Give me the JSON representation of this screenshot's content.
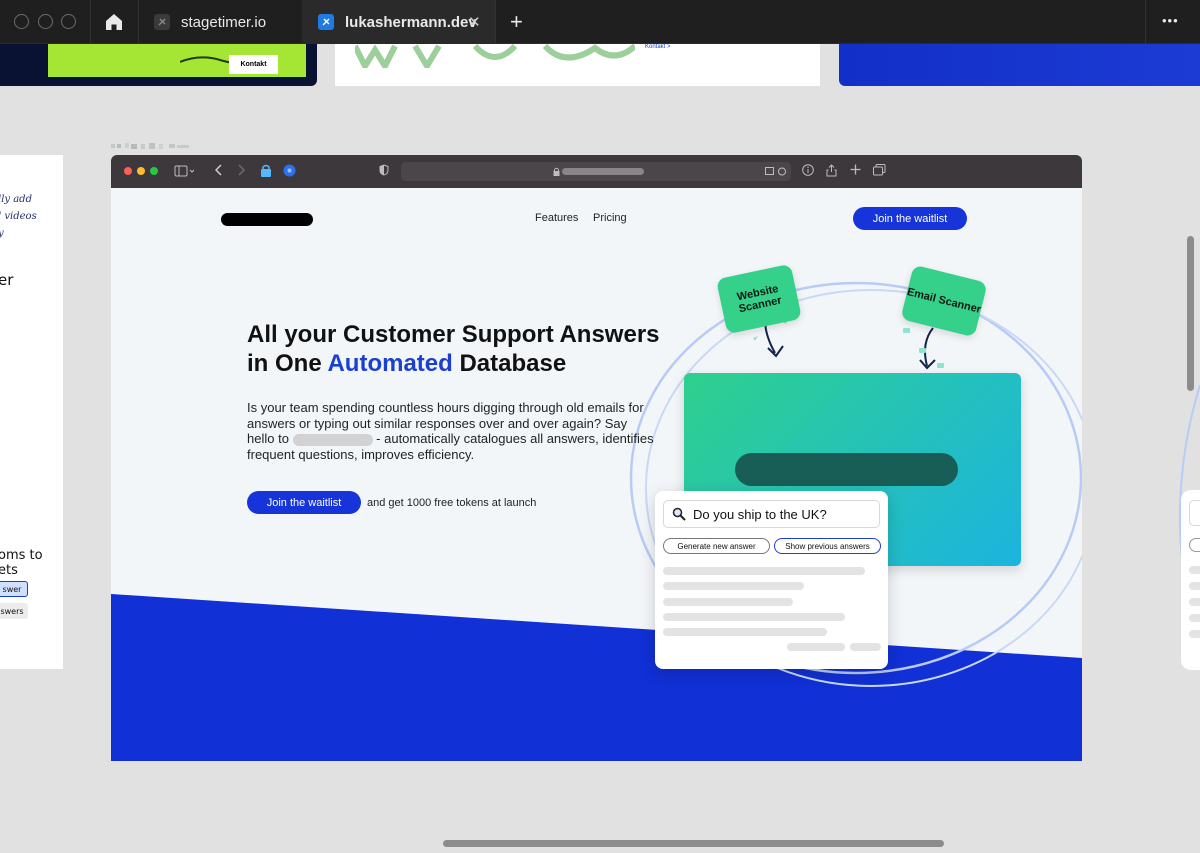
{
  "browser": {
    "tabs": [
      {
        "label": "stagetimer.io",
        "active": false
      },
      {
        "label": "lukashermann.dev",
        "active": true
      }
    ],
    "new_tab_symbol": "+",
    "more_symbol": "•••",
    "close_symbol": "✕"
  },
  "thumbnails": {
    "first_button": "Kontakt",
    "second_link": "Kontakt >"
  },
  "left_card": {
    "lines_top": [
      "lly add",
      "l videos",
      "y"
    ],
    "heading_fragment": "er",
    "bottom_lines": [
      "oms to",
      "ets"
    ],
    "chip_1": "swer",
    "chip_2": "swers"
  },
  "page": {
    "nav": {
      "features": "Features",
      "pricing": "Pricing"
    },
    "cta_top": "Join the waitlist",
    "hero": {
      "line1": "All your Customer Support Answers",
      "line2_before": "in One ",
      "line2_accent": "Automated",
      "line2_after": " Database",
      "p1": "Is your team spending countless hours digging through old emails for answers or typing out similar responses over and over again?",
      "p2_before": "Say hello to",
      "p2_after": "- automatically catalogues all answers, identifies frequent questions, improves efficiency."
    },
    "cta_bottom": "Join the waitlist",
    "cta_note": "and get 1000 free tokens at launch",
    "illustration": {
      "website_scanner": "Website Scanner",
      "email_scanner": "Email Scanner",
      "question": "Do you ship to the UK?",
      "btn_generate": "Generate new answer",
      "btn_previous": "Show previous answers"
    }
  },
  "colors": {
    "accent_blue": "#1634d9",
    "scanner_green": "#35d08a",
    "chrome_dark": "#1f1f1f"
  }
}
